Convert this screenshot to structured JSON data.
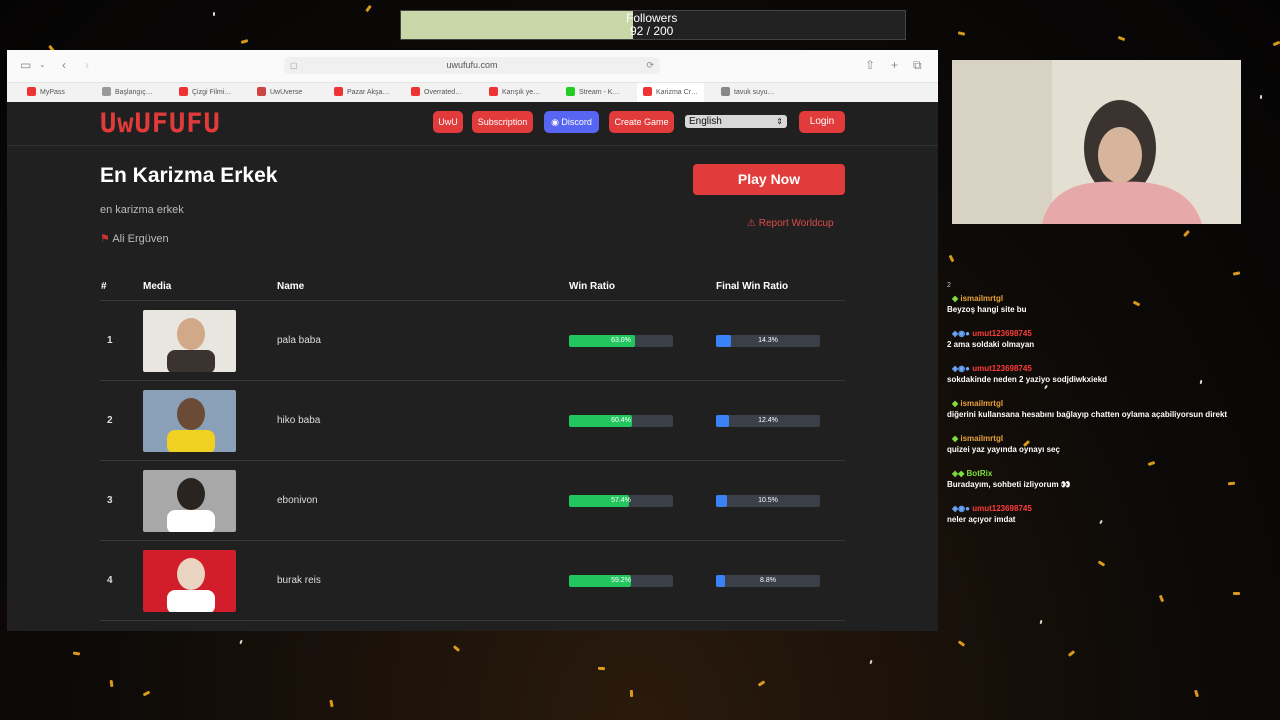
{
  "stream": {
    "followers_label": "Followers",
    "followers_count": "92 / 200",
    "followers_progress": 0.46
  },
  "browser": {
    "url": "uwufufu.com",
    "tabs": [
      "MyPass",
      "Başlangıç…",
      "Çizgi Filmi…",
      "UwUverse",
      "Pazar Akşa…",
      "Overrated…",
      "Karışık ye…",
      "Stream - K…",
      "Karizma Cr…",
      "tavuk suyu…"
    ]
  },
  "site": {
    "logo": "UwUFUFU",
    "nav": [
      "UwU",
      "Subscription",
      "Discord",
      "Create Game"
    ],
    "language": "English",
    "login": "Login",
    "title": "En Karizma Erkek",
    "subtitle": "en karizma erkek",
    "author": "Ali Ergüven",
    "play_now": "Play Now",
    "report": "Report Worldcup",
    "table_headers": [
      "#",
      "Media",
      "Name",
      "Win Ratio",
      "Final Win Ratio"
    ],
    "rows": [
      {
        "rank": "1",
        "name": "pala baba",
        "win": "63.0%",
        "final": "14.3%"
      },
      {
        "rank": "2",
        "name": "hiko baba",
        "win": "60.4%",
        "final": "12.4%"
      },
      {
        "rank": "3",
        "name": "ebonivon",
        "win": "57.4%",
        "final": "10.5%"
      },
      {
        "rank": "4",
        "name": "burak reis",
        "win": "59.2%",
        "final": "8.8%"
      }
    ],
    "win_color": "#22c55e",
    "final_color": "#3b82f6"
  },
  "chat": [
    {
      "user": "ismailmrtgl",
      "text": "Beyzoş hangi site bu",
      "color": "#e8a23c"
    },
    {
      "user": "umut123698745",
      "text": "2 ama soldaki olmayan",
      "color": "#ff3b3b"
    },
    {
      "user": "umut123698745",
      "text": "sokdakinde neden 2 yaziyo sodjdiwkxiekd",
      "color": "#ff3b3b"
    },
    {
      "user": "ismailmrtgl",
      "text": "diğerini kullansana hesabını bağlayıp chatten oylama açabiliyorsun direkt",
      "color": "#e8a23c"
    },
    {
      "user": "ismailmrtgl",
      "text": "quizei yaz yayında oynayı seç",
      "color": "#e8a23c"
    },
    {
      "user": "BotRix",
      "text": "Buradayım, sohbeti izliyorum 👀",
      "color": "#7ee03c"
    },
    {
      "user": "umut123698745",
      "text": "neler açıyor imdat",
      "color": "#ff3b3b"
    }
  ]
}
